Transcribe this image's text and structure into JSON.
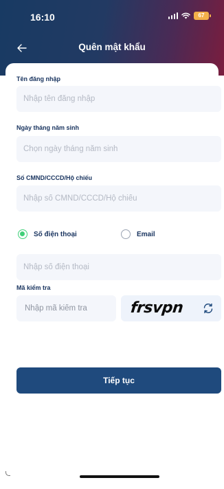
{
  "status_bar": {
    "time": "16:10",
    "battery": "67"
  },
  "nav": {
    "back_icon": "arrow-left-icon",
    "title": "Quên mật khẩu"
  },
  "form": {
    "username": {
      "label": "Tên đăng nhập",
      "placeholder": "Nhập tên đăng nhập"
    },
    "birthdate": {
      "label": "Ngày tháng năm sinh",
      "placeholder": "Chọn ngày tháng năm sinh"
    },
    "id_number": {
      "label": "Số CMND/CCCD/Hộ chiếu",
      "placeholder": "Nhập số CMND/CCCD/Hộ chiếu"
    },
    "contact_method": {
      "options": [
        {
          "label": "Số điện thoại",
          "selected": true
        },
        {
          "label": "Email",
          "selected": false
        }
      ]
    },
    "phone": {
      "placeholder": "Nhập số điện thoại"
    },
    "captcha": {
      "label": "Mã kiểm tra",
      "placeholder": "Nhập mã kiểm tra",
      "code": "frsvpn",
      "refresh_icon": "refresh-icon"
    },
    "submit_label": "Tiếp tục"
  },
  "colors": {
    "primary": "#1f4a7d",
    "label": "#1a3560",
    "radio_active": "#3fcf78",
    "input_bg": "#f4f6fb",
    "battery": "#f3b04a"
  }
}
